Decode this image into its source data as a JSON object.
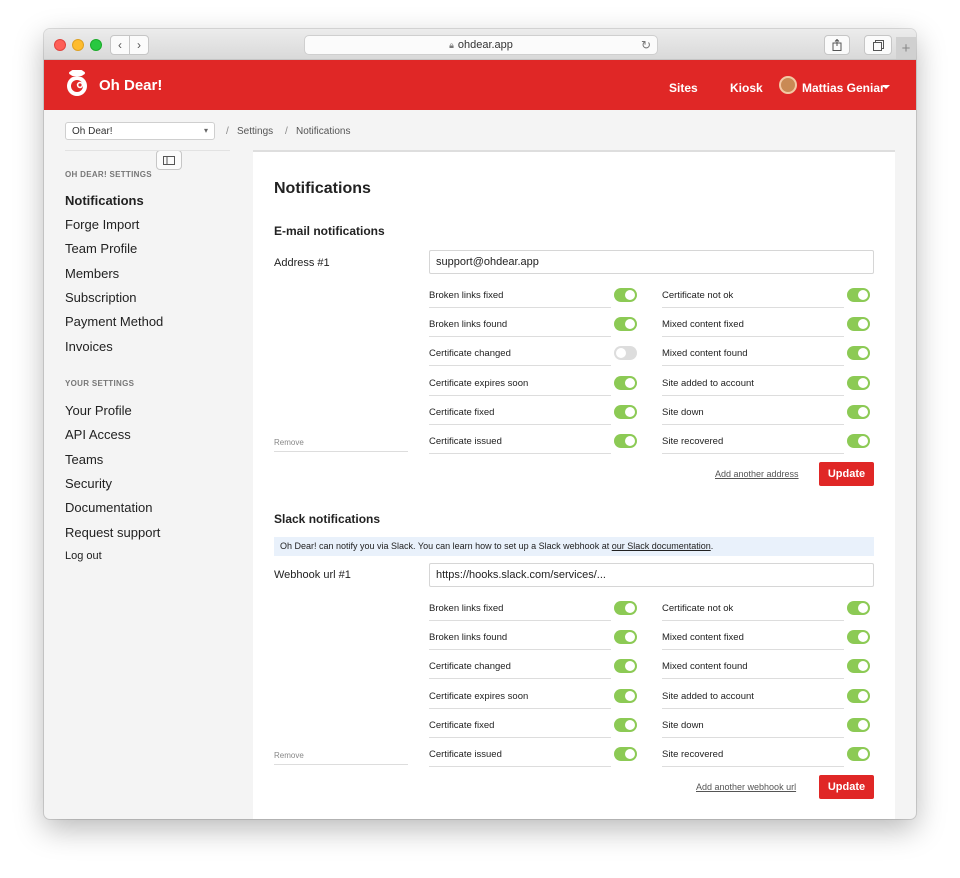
{
  "browser": {
    "url": "ohdear.app"
  },
  "nav": {
    "brand": "Oh Dear!",
    "links": [
      "Sites",
      "Kiosk"
    ],
    "user": "Mattias Geniar"
  },
  "breadcrumb": {
    "site_select": "Oh Dear!",
    "separator": "/",
    "items": [
      "Settings",
      "Notifications"
    ]
  },
  "sidebar": {
    "team_heading": "OH DEAR! SETTINGS",
    "team_items": [
      "Notifications",
      "Forge Import",
      "Team Profile",
      "Members",
      "Subscription",
      "Payment Method",
      "Invoices"
    ],
    "user_heading": "YOUR SETTINGS",
    "user_items": [
      "Your Profile",
      "API Access",
      "Teams",
      "Security",
      "Documentation",
      "Request support",
      "Log out"
    ]
  },
  "main": {
    "title": "Notifications",
    "email": {
      "heading": "E-mail notifications",
      "address_label": "Address #1",
      "address_value": "support@ohdear.app",
      "remove_label": "Remove",
      "left_toggles": [
        {
          "label": "Broken links fixed",
          "on": true
        },
        {
          "label": "Broken links found",
          "on": true
        },
        {
          "label": "Certificate changed",
          "on": false
        },
        {
          "label": "Certificate expires soon",
          "on": true
        },
        {
          "label": "Certificate fixed",
          "on": true
        },
        {
          "label": "Certificate issued",
          "on": true
        }
      ],
      "right_toggles": [
        {
          "label": "Certificate not ok",
          "on": true
        },
        {
          "label": "Mixed content fixed",
          "on": true
        },
        {
          "label": "Mixed content found",
          "on": true
        },
        {
          "label": "Site added to account",
          "on": true
        },
        {
          "label": "Site down",
          "on": true
        },
        {
          "label": "Site recovered",
          "on": true
        }
      ],
      "add_link": "Add another address",
      "update_button": "Update"
    },
    "slack": {
      "heading": "Slack notifications",
      "info_text": "Oh Dear! can notify you via Slack. You can learn how to set up a Slack webhook at ",
      "info_link": "our Slack documentation",
      "info_end": ".",
      "webhook_label": "Webhook url #1",
      "webhook_value": "https://hooks.slack.com/services/...",
      "remove_label": "Remove",
      "left_toggles": [
        {
          "label": "Broken links fixed",
          "on": true
        },
        {
          "label": "Broken links found",
          "on": true
        },
        {
          "label": "Certificate changed",
          "on": true
        },
        {
          "label": "Certificate expires soon",
          "on": true
        },
        {
          "label": "Certificate fixed",
          "on": true
        },
        {
          "label": "Certificate issued",
          "on": true
        }
      ],
      "right_toggles": [
        {
          "label": "Certificate not ok",
          "on": true
        },
        {
          "label": "Mixed content fixed",
          "on": true
        },
        {
          "label": "Mixed content found",
          "on": true
        },
        {
          "label": "Site added to account",
          "on": true
        },
        {
          "label": "Site down",
          "on": true
        },
        {
          "label": "Site recovered",
          "on": true
        }
      ],
      "add_link": "Add another webhook url",
      "update_button": "Update"
    }
  },
  "colors": {
    "brand_red": "#e02726",
    "toggle_on": "#8cca55",
    "toggle_off": "#dddddd",
    "info_bg": "#e9f1fb"
  },
  "icons": [
    "back-icon",
    "forward-icon",
    "sidebar-toggle-icon",
    "lock-icon",
    "reload-icon",
    "share-icon",
    "tabs-icon",
    "new-tab-icon",
    "oh-dear-logo",
    "avatar"
  ]
}
